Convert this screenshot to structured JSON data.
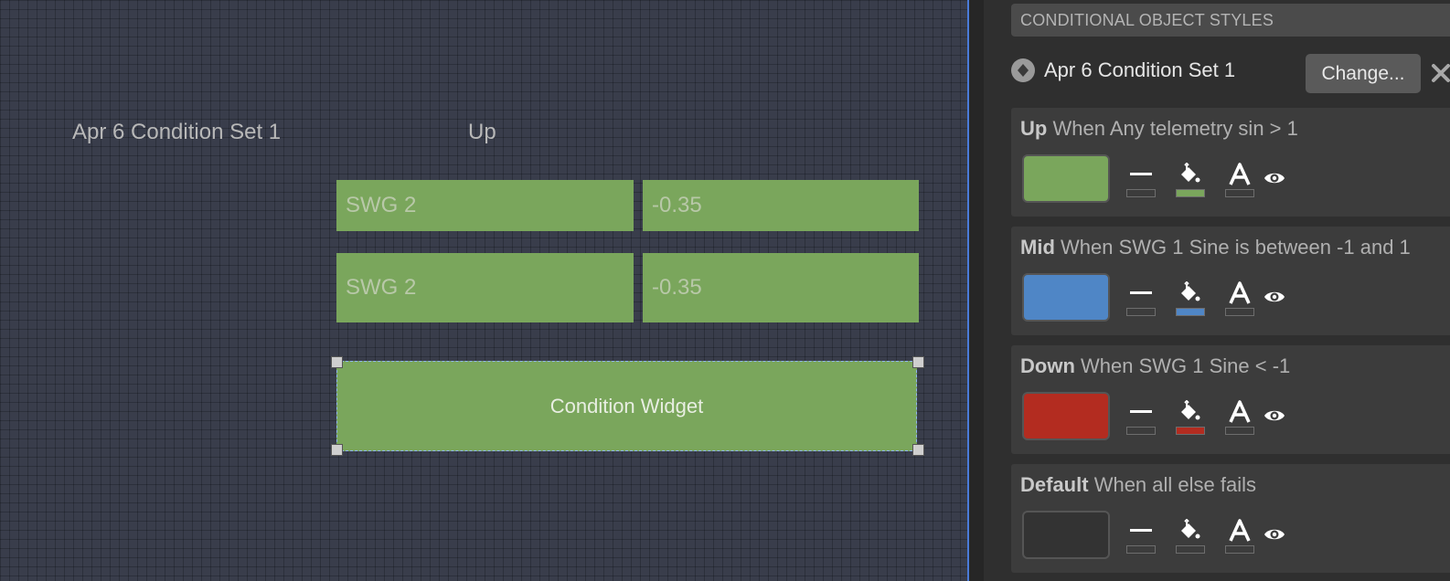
{
  "canvas": {
    "set_label": "Apr 6 Condition Set 1",
    "state_label": "Up",
    "rows": [
      {
        "name": "SWG 2",
        "value": "-0.35"
      },
      {
        "name": "SWG 2",
        "value": "-0.35"
      }
    ],
    "widget_label": "Condition Widget",
    "accent_color": "#7aa65c"
  },
  "panel": {
    "header": "CONDITIONAL OBJECT STYLES",
    "set_name": "Apr 6 Condition Set 1",
    "change_label": "Change...",
    "close_icon": "close-icon",
    "collapse_icon": "collapse-toggle-icon",
    "conditions": [
      {
        "name": "Up",
        "criteria": "When Any telemetry sin > 1",
        "color": "#7aa65c"
      },
      {
        "name": "Mid",
        "criteria": "When SWG 1 Sine is between -1 and 1",
        "color": "#4f86c6"
      },
      {
        "name": "Down",
        "criteria": "When SWG 1 Sine < -1",
        "color": "#b32c20"
      },
      {
        "name": "Default",
        "criteria": "When all else fails",
        "color": "#333333"
      }
    ]
  }
}
